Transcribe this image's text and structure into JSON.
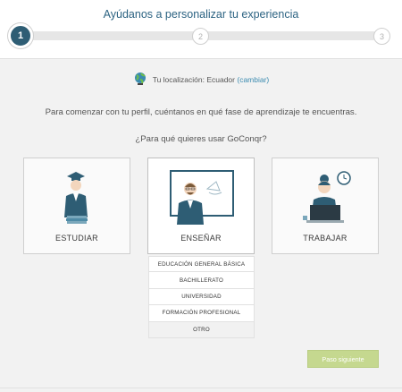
{
  "header": {
    "title": "Ayúdanos a personalizar tu experiencia",
    "steps": [
      "1",
      "2",
      "3"
    ]
  },
  "location": {
    "label": "Tu localización: Ecuador",
    "change_link": "(cambiar)"
  },
  "intro": "Para comenzar con tu perfil, cuéntanos en qué fase de aprendizaje te encuentras.",
  "question": "¿Para qué quieres usar GoConqr?",
  "options": [
    {
      "label": "ESTUDIAR",
      "icon": "student-icon"
    },
    {
      "label": "ENSEÑAR",
      "icon": "teacher-icon"
    },
    {
      "label": "TRABAJAR",
      "icon": "worker-icon"
    }
  ],
  "teach_levels": [
    "EDUCACIÓN GENERAL BÁSICA",
    "BACHILLERATO",
    "UNIVERSIDAD",
    "FORMACIÓN PROFESIONAL",
    "OTRO"
  ],
  "next_button": "Paso siguiente",
  "colors": {
    "primary": "#2e5d74",
    "link": "#3b8bb0",
    "next_button": "#c5d88f"
  }
}
